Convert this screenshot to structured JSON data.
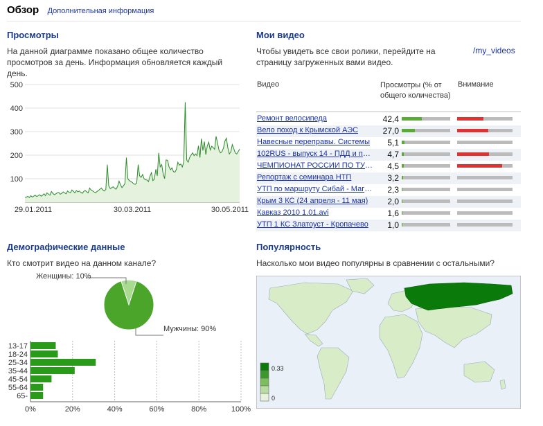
{
  "header": {
    "title": "Обзор",
    "more_info": "Дополнительная информация"
  },
  "views": {
    "title": "Просмотры",
    "description": "На данной диаграмме показано общее количество просмотров за день. Информация обновляется каждый день.",
    "chart_data": {
      "type": "area",
      "ylim": [
        0,
        500
      ],
      "yticks": [
        "500",
        "400",
        "300",
        "200",
        "100"
      ],
      "xticks": [
        "29.01.2011",
        "30.03.2011",
        "30.05.2011"
      ],
      "values": [
        20,
        22,
        25,
        20,
        28,
        22,
        26,
        30,
        24,
        28,
        32,
        26,
        30,
        36,
        28,
        40,
        34,
        30,
        46,
        38,
        32,
        36,
        40,
        42,
        34,
        38,
        44,
        40,
        36,
        48,
        42,
        40,
        52,
        46,
        40,
        50,
        44,
        48,
        42,
        38,
        46,
        50,
        44,
        40,
        60,
        52,
        48,
        44,
        40,
        46,
        50,
        56,
        60,
        52,
        48,
        55,
        160,
        70,
        58,
        62,
        66,
        60,
        56,
        68,
        90,
        74,
        62,
        70,
        80,
        190,
        100,
        92,
        88,
        84,
        78,
        76,
        82,
        160,
        112,
        106,
        118,
        100,
        96,
        94,
        88,
        110,
        126,
        92,
        98,
        140,
        112,
        210,
        150,
        160,
        120,
        100,
        180,
        178,
        150,
        138,
        146,
        130,
        128,
        140,
        170,
        158,
        162,
        150,
        170,
        425,
        180,
        170,
        190,
        200,
        210,
        198,
        205,
        198,
        240,
        190,
        270,
        220,
        258,
        202,
        240,
        255,
        222,
        238,
        232,
        225,
        280,
        250,
        220,
        210,
        215,
        230,
        260,
        272,
        230,
        205,
        215,
        245,
        228,
        210,
        205,
        215,
        226
      ]
    }
  },
  "my_videos": {
    "title": "Мои видео",
    "description": "Чтобы увидеть все свои ролики, перейдите на страницу загруженных вами видео.",
    "link": "/my_videos",
    "col_video": "Видео",
    "col_views": "Просмотры (% от общего количества)",
    "col_attention": "Внимание",
    "rows": [
      {
        "name": "Ремонт велосипеда",
        "value": "42,4",
        "views": 0.42,
        "attention": 0.48
      },
      {
        "name": "Вело поход к Крымской АЭС",
        "value": "27,0",
        "views": 0.27,
        "attention": 0.56
      },
      {
        "name": "Навесные переправы. Системы",
        "value": "5,1",
        "views": 0.05,
        "attention": 0.0
      },
      {
        "name": "102RUS - выпуск 14 - ПДД и правила",
        "value": "4,7",
        "views": 0.04,
        "attention": 0.58
      },
      {
        "name": "ЧЕМПИОНАТ РОССИИ ПО ТУРИЗМУ",
        "value": "4,5",
        "views": 0.04,
        "attention": 0.81
      },
      {
        "name": "Репортаж с семинара НТП",
        "value": "3,2",
        "views": 0.03,
        "attention": 0.0
      },
      {
        "name": "УТП по маршруту Сибай - Магнитогорск",
        "value": "2,3",
        "views": 0.02,
        "attention": 0.0
      },
      {
        "name": "Крым 3 КС (24 апреля - 11 мая)",
        "value": "2,0",
        "views": 0.02,
        "attention": 0.0
      },
      {
        "name": "Кавказ 2010  1.01.avi",
        "value": "1,6",
        "views": 0.01,
        "attention": 0.0
      },
      {
        "name": "УТП 1 КС Златоуст - Кропачево",
        "value": "1,0",
        "views": 0.01,
        "attention": 0.0
      }
    ]
  },
  "demographics": {
    "title": "Демографические данные",
    "question": "Кто смотрит видео на данном канале?",
    "pie": {
      "women_label": "Женщины: 10%",
      "men_label": "Мужчины: 90%",
      "women": 10,
      "men": 90
    },
    "age_chart": {
      "type": "bar",
      "categories": [
        "13-17",
        "18-24",
        "25-34",
        "35-44",
        "45-54",
        "55-64",
        "65-"
      ],
      "values": [
        12,
        13,
        31,
        21,
        10,
        6,
        6
      ],
      "xticks": [
        "0%",
        "20%",
        "40%",
        "60%",
        "80%",
        "100%"
      ],
      "xlim": [
        0,
        100
      ]
    }
  },
  "popularity": {
    "title": "Популярность",
    "question": "Насколько мои видео популярны в сравнении с остальными?",
    "legend_max": "0.33",
    "legend_min": "0"
  },
  "colors": {
    "link": "#1a33a8",
    "chart_line": "#2a8a2a",
    "bar_green": "#2a9a1a",
    "map_land": "#d8ecc8",
    "map_highlight": "#0a7a0a"
  }
}
